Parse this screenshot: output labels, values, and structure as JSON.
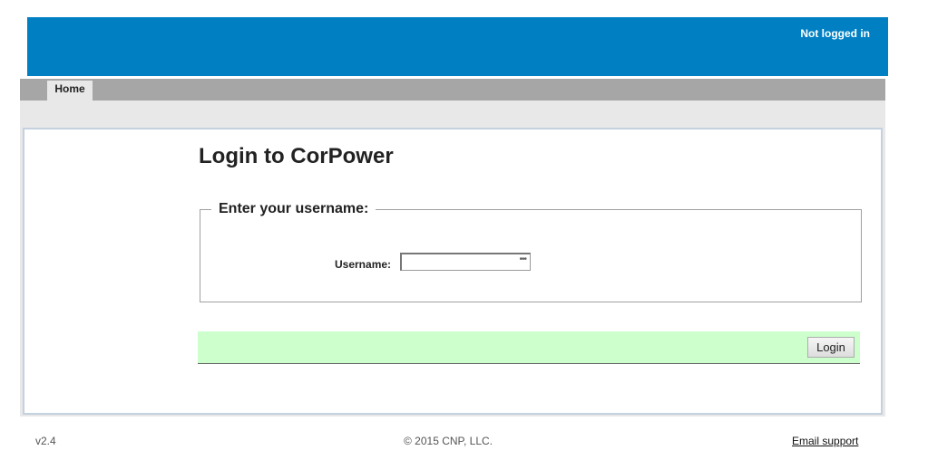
{
  "header": {
    "login_status": "Not logged in",
    "banner_color": "#0080c3"
  },
  "nav": {
    "tabs": [
      {
        "label": "Home",
        "active": true
      }
    ]
  },
  "main": {
    "title": "Login to CorPower",
    "fieldset_legend": "Enter your username:",
    "username": {
      "label": "Username:",
      "value": "",
      "autofill_indicator": "•••"
    },
    "action_bar_color": "#ccffcc",
    "login_button_label": "Login"
  },
  "footer": {
    "version": "v2.4",
    "copyright": "© 2015 CNP, LLC.",
    "support_link": "Email support"
  }
}
